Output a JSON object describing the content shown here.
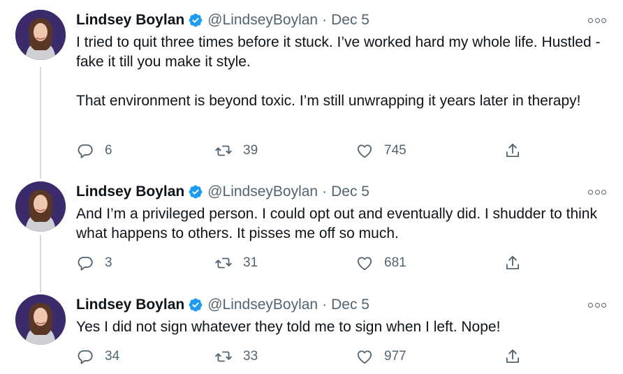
{
  "tweets": [
    {
      "author": {
        "name": "Lindsey Boylan",
        "handle": "@LindseyBoylan",
        "verified": true
      },
      "date": "Dec 5",
      "paragraphs": [
        "I tried to quit three times before it stuck. I’ve worked hard my whole life. Hustled - fake it till you make it style.",
        "That environment is beyond toxic. I’m still unwrapping it years later in therapy!"
      ],
      "stats": {
        "replies": "6",
        "retweets": "39",
        "likes": "745"
      }
    },
    {
      "author": {
        "name": "Lindsey Boylan",
        "handle": "@LindseyBoylan",
        "verified": true
      },
      "date": "Dec 5",
      "paragraphs": [
        "And I’m a privileged person. I could opt out and eventually did. I shudder to think what happens to others. It pisses me off so much."
      ],
      "stats": {
        "replies": "3",
        "retweets": "31",
        "likes": "681"
      }
    },
    {
      "author": {
        "name": "Lindsey Boylan",
        "handle": "@LindseyBoylan",
        "verified": true
      },
      "date": "Dec 5",
      "paragraphs": [
        "Yes I did not sign whatever they told me to sign when I left. Nope!"
      ],
      "stats": {
        "replies": "34",
        "retweets": "33",
        "likes": "977"
      }
    }
  ],
  "separator": "·",
  "icons": {
    "verified": "verified-badge-icon",
    "reply": "reply-icon",
    "retweet": "retweet-icon",
    "like": "heart-icon",
    "share": "share-icon",
    "more": "more-icon"
  },
  "colors": {
    "text": "#0f1419",
    "secondary": "#536471",
    "verified": "#1d9bf0",
    "thread_line": "#cfd9de"
  }
}
